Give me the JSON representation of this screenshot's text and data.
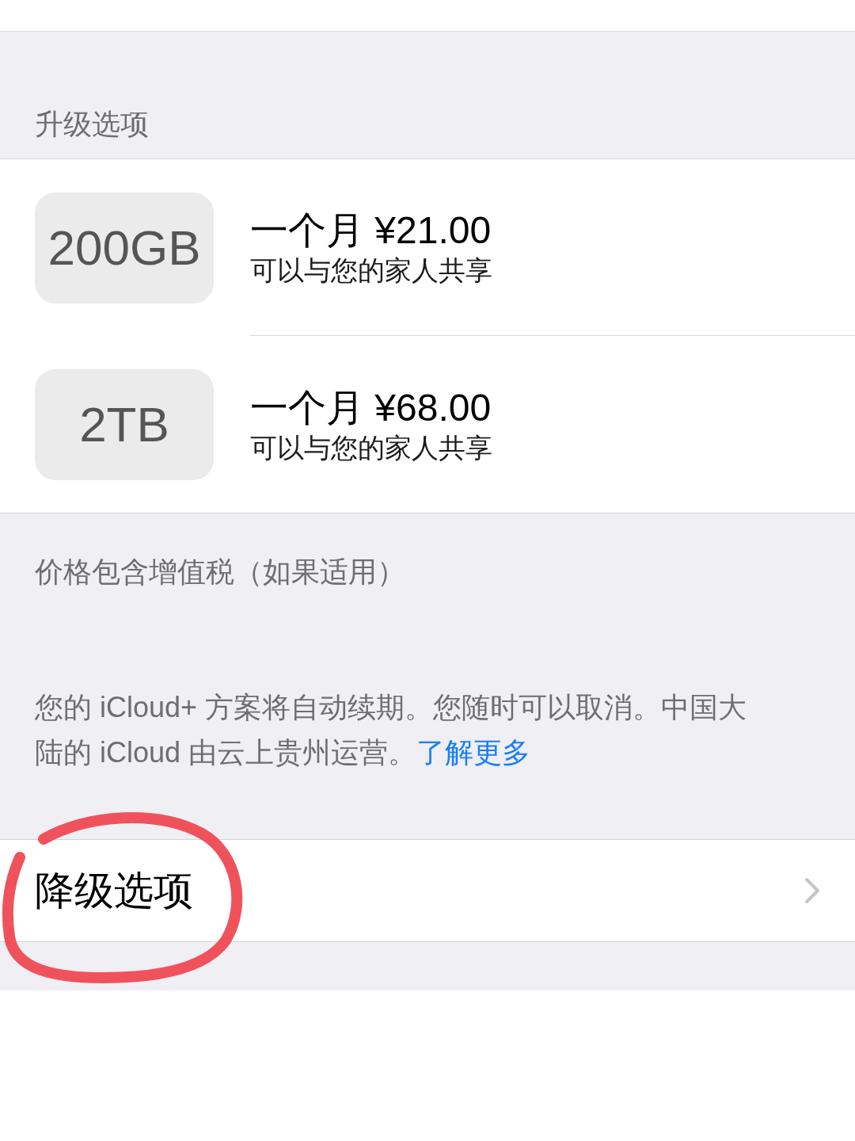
{
  "upgrade_section": {
    "header": "升级选项",
    "plans": [
      {
        "storage": "200GB",
        "price": "一个月 ¥21.00",
        "note": "可以与您的家人共享"
      },
      {
        "storage": "2TB",
        "price": "一个月 ¥68.00",
        "note": "可以与您的家人共享"
      }
    ],
    "footer": "价格包含增值税（如果适用）"
  },
  "renewal_note": {
    "text": "您的 iCloud+ 方案将自动续期。您随时可以取消。中国大陆的 iCloud 由云上贵州运营。",
    "link": "了解更多"
  },
  "downgrade_row": {
    "label": "降级选项"
  },
  "annotation": {
    "kind": "circle"
  }
}
